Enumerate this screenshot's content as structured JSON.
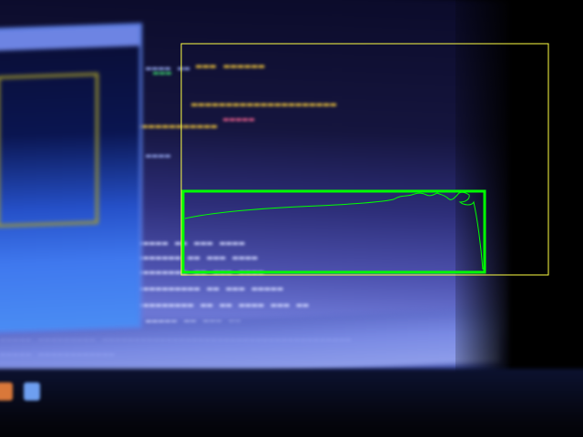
{
  "scene": {
    "kind": "blurred photo of a laptop screen running a detection demo",
    "colors": {
      "yellow_box": "#ffff44",
      "green_box": "#00ff00",
      "green_contour": "#00ff00",
      "screen_glow": "#4e53b0"
    },
    "icons": [
      "taskbar-app-icon-orange",
      "taskbar-app-icon-blue"
    ]
  }
}
